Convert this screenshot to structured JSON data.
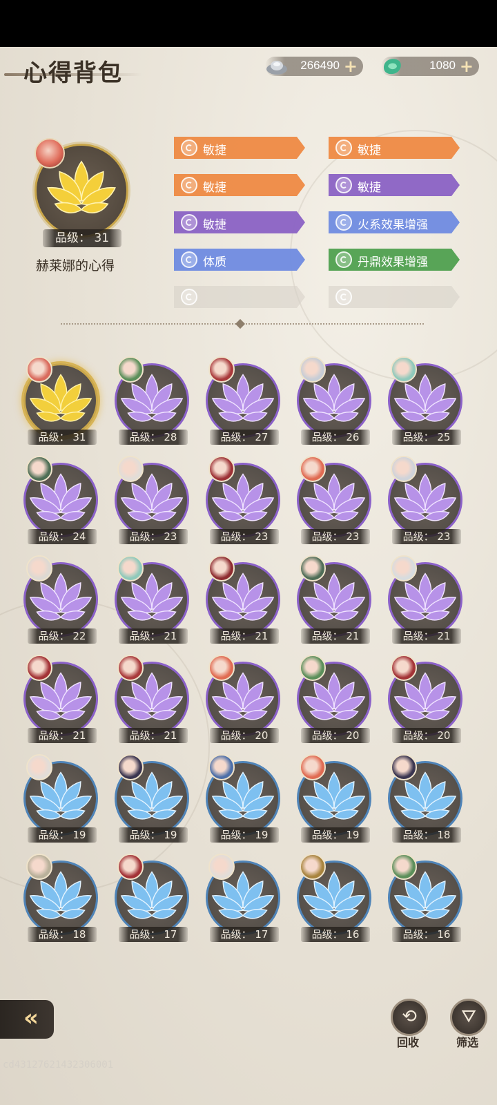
{
  "header": {
    "title": "心得背包",
    "currencies": [
      {
        "icon": "silver-ingot-icon",
        "value": "266490",
        "plus": "+"
      },
      {
        "icon": "jade-coin-icon",
        "value": "1080",
        "plus": "+"
      }
    ]
  },
  "preview": {
    "grade_text": "品级： 31",
    "name": "赫莱娜的心得",
    "lotus_color": "gold"
  },
  "attributes": [
    {
      "label": "敏捷",
      "color": "#ee8a43"
    },
    {
      "label": "敏捷",
      "color": "#ee8a43"
    },
    {
      "label": "敏捷",
      "color": "#ee8a43"
    },
    {
      "label": "敏捷",
      "color": "#8a62c4"
    },
    {
      "label": "敏捷",
      "color": "#8a62c4"
    },
    {
      "label": "火系效果增强",
      "color": "#6f8be0"
    },
    {
      "label": "体质",
      "color": "#6f8be0"
    },
    {
      "label": "丹鼎效果增强",
      "color": "#4fa04f"
    },
    {
      "label": "",
      "color": "#d6d0c6"
    },
    {
      "label": "",
      "color": "#d6d0c6"
    }
  ],
  "grid": [
    {
      "grade": "品级： 31",
      "tier": "gold",
      "avatar": "#d96a5c"
    },
    {
      "grade": "品级： 28",
      "tier": "purple",
      "avatar": "#5b8f5a"
    },
    {
      "grade": "品级： 27",
      "tier": "purple",
      "avatar": "#a93a3c"
    },
    {
      "grade": "品级： 26",
      "tier": "purple",
      "avatar": "#c7cdd6"
    },
    {
      "grade": "品级： 25",
      "tier": "purple",
      "avatar": "#8fc9bb"
    },
    {
      "grade": "品级： 24",
      "tier": "purple",
      "avatar": "#4d6e55"
    },
    {
      "grade": "品级： 23",
      "tier": "purple",
      "avatar": "#e2ddd8"
    },
    {
      "grade": "品级： 23",
      "tier": "purple",
      "avatar": "#9d3236"
    },
    {
      "grade": "品级： 23",
      "tier": "purple",
      "avatar": "#e06b52"
    },
    {
      "grade": "品级： 23",
      "tier": "purple",
      "avatar": "#cfd3da"
    },
    {
      "grade": "品级： 22",
      "tier": "purple",
      "avatar": "#ddd9d3"
    },
    {
      "grade": "品级： 21",
      "tier": "purple",
      "avatar": "#8fc9bb"
    },
    {
      "grade": "品级： 21",
      "tier": "purple",
      "avatar": "#8e2c30"
    },
    {
      "grade": "品级： 21",
      "tier": "purple",
      "avatar": "#4f6d57"
    },
    {
      "grade": "品级： 21",
      "tier": "purple",
      "avatar": "#d7dcdf"
    },
    {
      "grade": "品级： 21",
      "tier": "purple",
      "avatar": "#a33337"
    },
    {
      "grade": "品级： 21",
      "tier": "purple",
      "avatar": "#a93a3c"
    },
    {
      "grade": "品级： 20",
      "tier": "purple",
      "avatar": "#e06b52"
    },
    {
      "grade": "品级： 20",
      "tier": "purple",
      "avatar": "#5b8f5a"
    },
    {
      "grade": "品级： 20",
      "tier": "purple",
      "avatar": "#a33337"
    },
    {
      "grade": "品级： 19",
      "tier": "blue",
      "avatar": "#e2ddd8"
    },
    {
      "grade": "品级： 19",
      "tier": "blue",
      "avatar": "#3a3550"
    },
    {
      "grade": "品级： 19",
      "tier": "blue",
      "avatar": "#4d6fa8"
    },
    {
      "grade": "品级： 19",
      "tier": "blue",
      "avatar": "#e06b52"
    },
    {
      "grade": "品级： 18",
      "tier": "blue",
      "avatar": "#3a3550"
    },
    {
      "grade": "品级： 18",
      "tier": "blue",
      "avatar": "#b8b09a"
    },
    {
      "grade": "品级： 17",
      "tier": "blue",
      "avatar": "#a33337"
    },
    {
      "grade": "品级： 17",
      "tier": "blue",
      "avatar": "#e2ddd8"
    },
    {
      "grade": "品级： 16",
      "tier": "blue",
      "avatar": "#a8843e"
    },
    {
      "grade": "品级： 16",
      "tier": "blue",
      "avatar": "#5b8f5a"
    }
  ],
  "buttons": {
    "recycle_label": "回收",
    "filter_label": "筛选"
  },
  "watermark": "cd43127621432306001"
}
